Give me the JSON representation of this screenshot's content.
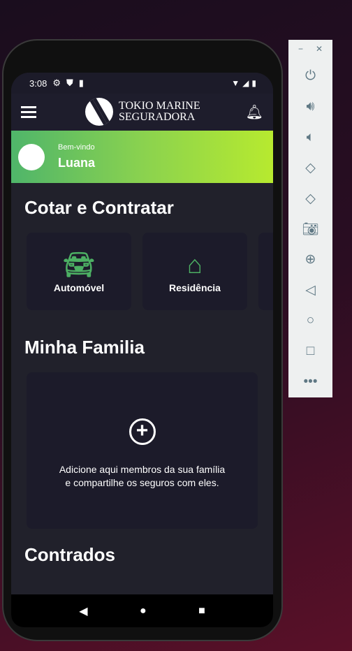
{
  "status": {
    "time": "3:08"
  },
  "header": {
    "brand_line1": "TOKIO MARINE",
    "brand_line2": "SEGURADORA"
  },
  "banner": {
    "greeting": "Bem-vindo",
    "name": "Luana"
  },
  "quote": {
    "title": "Cotar e Contratar",
    "cards": [
      {
        "label": "Automóvel",
        "icon": "car-icon"
      },
      {
        "label": "Residência",
        "icon": "home-icon"
      }
    ]
  },
  "family": {
    "title": "Minha Familia",
    "text_line1": "Adicione aqui membros da sua família",
    "text_line2": "e  compartilhe os seguros com eles."
  },
  "contracted": {
    "title": "Contrados"
  },
  "accent": "#4caf63"
}
